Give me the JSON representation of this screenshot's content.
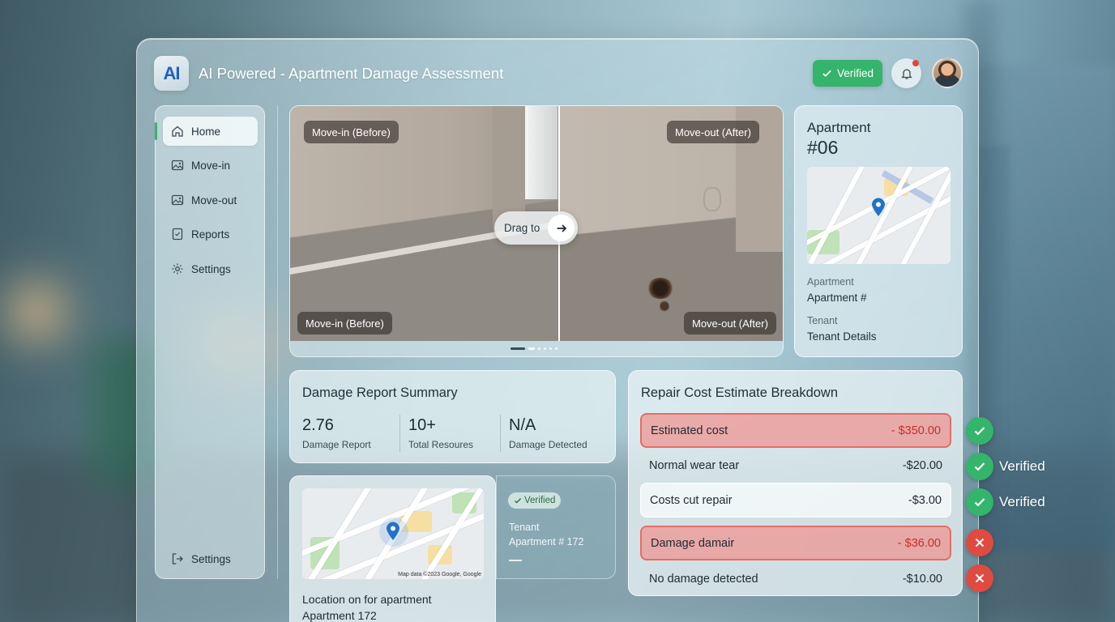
{
  "app": {
    "title": "AI Powered - Apartment Damage Assessment",
    "logo_text": "AI",
    "verified_label": "Verified",
    "accent": "#35b46b"
  },
  "sidebar": {
    "items": [
      {
        "label": "Home",
        "icon": "home-icon",
        "active": true
      },
      {
        "label": "Move-in",
        "icon": "image-icon"
      },
      {
        "label": "Move-out",
        "icon": "image-icon"
      },
      {
        "label": "Reports",
        "icon": "report-icon"
      },
      {
        "label": "Settings",
        "icon": "gear-icon"
      }
    ],
    "footer": {
      "label": "Settings",
      "icon": "logout-icon"
    }
  },
  "compare": {
    "top_left_label": "Move-in (Before)",
    "top_right_label": "Move-out (After)",
    "bottom_left_label": "Move-in (Before)",
    "bottom_right_label": "Move-out (After)",
    "drag_label": "Drag to"
  },
  "apartment": {
    "title": "Apartment",
    "number": "#06",
    "apartment_label": "Apartment",
    "apartment_value": "Apartment #",
    "tenant_label": "Tenant",
    "tenant_value": "Tenant Details"
  },
  "summary": {
    "title": "Damage Report Summary",
    "stats": [
      {
        "value": "2.76",
        "label": "Damage Report"
      },
      {
        "value": "10+",
        "label": "Total Resoures"
      },
      {
        "value": "N/A",
        "label": "Damage Detected"
      }
    ]
  },
  "location": {
    "text": "Location on for apartment Apartment 172",
    "map_attribution": "Map data ©2023 Google, Google"
  },
  "tenant": {
    "verified_label": "Verified",
    "line1": "Tenant",
    "line2": "Apartment # 172"
  },
  "repair": {
    "title": "Repair Cost Estimate Breakdown",
    "rows": [
      {
        "label": "Estimated cost",
        "amount": "- $350.00",
        "style": "alert",
        "status": "ok",
        "status_text": ""
      },
      {
        "label": "Normal wear tear",
        "amount": "-$20.00",
        "style": "plain",
        "status": "ok",
        "status_text": "Verified"
      },
      {
        "label": "Costs cut repair",
        "amount": "-$3.00",
        "style": "box",
        "status": "ok",
        "status_text": "Verified"
      },
      {
        "label": "Damage damair",
        "amount": "- $36.00",
        "style": "alert",
        "status": "bad",
        "status_text": ""
      },
      {
        "label": "No damage detected",
        "amount": "-$10.00",
        "style": "plain",
        "status": "bad",
        "status_text": ""
      }
    ]
  }
}
